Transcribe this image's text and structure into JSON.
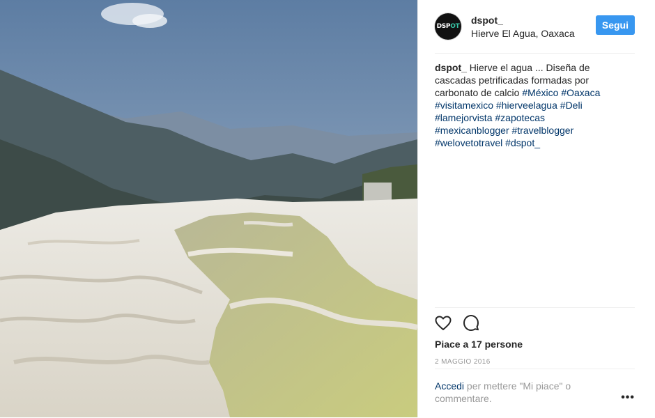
{
  "header": {
    "avatar_text_main": "DSP",
    "avatar_text_accent": "OT",
    "username": "dspot_",
    "location": "Hierve El Agua, Oaxaca",
    "follow_label": "Segui"
  },
  "caption": {
    "author": "dspot_",
    "text": "Hierve el agua ... Diseña de cascadas petrificadas formadas por carbonato de calcio",
    "hashtags": [
      "#México",
      "#Oaxaca",
      "#visitamexico",
      "#hierveelagua",
      "#Deli",
      "#lamejorvista",
      "#zapotecas",
      "#mexicanblogger",
      "#travelblogger",
      "#welovetotravel",
      "#dspot_"
    ]
  },
  "actions": {
    "like_icon": "heart-icon",
    "comment_icon": "speech-bubble-icon"
  },
  "likes_text": "Piace a 17 persone",
  "date": "2 MAGGIO 2016",
  "comment": {
    "login_link": "Accedi",
    "prompt": "per mettere \"Mi piace\" o commentare.",
    "more_icon": "more-options-icon"
  },
  "colors": {
    "accent": "#3897f0",
    "link": "#003569",
    "text": "#262626",
    "muted": "#999999"
  }
}
